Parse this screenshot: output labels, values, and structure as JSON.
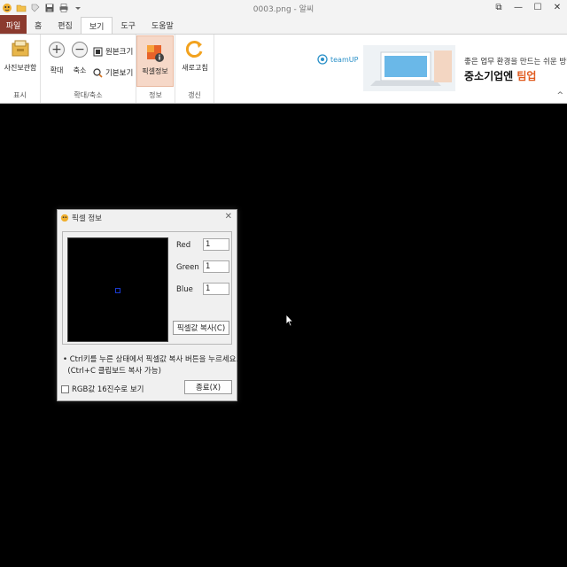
{
  "titlebar": {
    "title": "0003.png - 알씨",
    "restore_label": "⧉",
    "minimize_label": "—",
    "maximize_label": "☐",
    "close_label": "✕"
  },
  "menu": {
    "tabs": [
      "파일",
      "홈",
      "편집",
      "보기",
      "도구",
      "도움말"
    ],
    "active": "보기"
  },
  "ribbon": {
    "groups": {
      "show": "표시",
      "zoom": "확대/축소",
      "info": "정보",
      "refresh": "갱신"
    },
    "buttons": {
      "photo_storage": "사진보관함",
      "zoom_in": "확대",
      "zoom_out": "축소",
      "original_size": "원본크기",
      "default_view": "기본보기",
      "pixel_info": "픽셀정보",
      "refresh": "새로고침"
    },
    "zoom_in_glyph": "+",
    "zoom_out_glyph": "−",
    "collapse_glyph": "^"
  },
  "ad": {
    "logo": "teamUP",
    "line1": "좋은 업무 환경을 만드는 쉬운 방법",
    "line2_prefix": "중소기업엔 ",
    "line2_highlight": "팀업"
  },
  "dialog": {
    "title": "픽셀 정보",
    "close_label": "✕",
    "red_label": "Red",
    "red_value": "1",
    "green_label": "Green",
    "green_value": "1",
    "blue_label": "Blue",
    "blue_value": "1",
    "copy_button": "픽셀값 복사(C)",
    "instruction_line1": "• Ctrl키를 누른 상태에서 픽셀값 복사 버튼을 누르세요.",
    "instruction_line2": "  (Ctrl+C 클립보드 복사 가능)",
    "hex_checkbox_label": "RGB값 16진수로 보기",
    "hex_checked": false,
    "close_button": "종료(X)"
  },
  "colors": {
    "file_tab": "#8b3a2e",
    "pixel_info_highlight": "#f6d8c8",
    "canvas": "#000000",
    "ad_highlight": "#e05a1e"
  }
}
